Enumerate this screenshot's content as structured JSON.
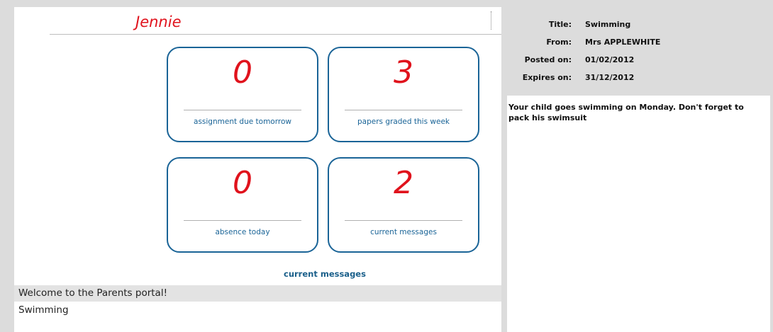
{
  "student": {
    "name": "Jennie"
  },
  "tiles": {
    "assignments": {
      "count": "0",
      "label": "assignment due tomorrow"
    },
    "papers": {
      "count": "3",
      "label": "papers graded this week"
    },
    "absence": {
      "count": "0",
      "label": "absence today"
    },
    "messages": {
      "count": "2",
      "label": "current messages"
    }
  },
  "links": {
    "current_messages": "current messages"
  },
  "welcome": {
    "text": "Welcome to the Parents portal!"
  },
  "message_list": [
    {
      "title": "Swimming"
    }
  ],
  "detail": {
    "title_label": "Title:",
    "title_value": "Swimming",
    "from_label": "From:",
    "from_value": "Mrs APPLEWHITE",
    "posted_label": "Posted on:",
    "posted_value": "01/02/2012",
    "expires_label": "Expires on:",
    "expires_value": "31/12/2012",
    "body": "Your child goes swimming on Monday. Don't forget to pack his swimsuit"
  },
  "colors": {
    "page_bg": "#dcdcdc",
    "accent_blue": "#1a6497",
    "count_red": "#e0121c"
  }
}
